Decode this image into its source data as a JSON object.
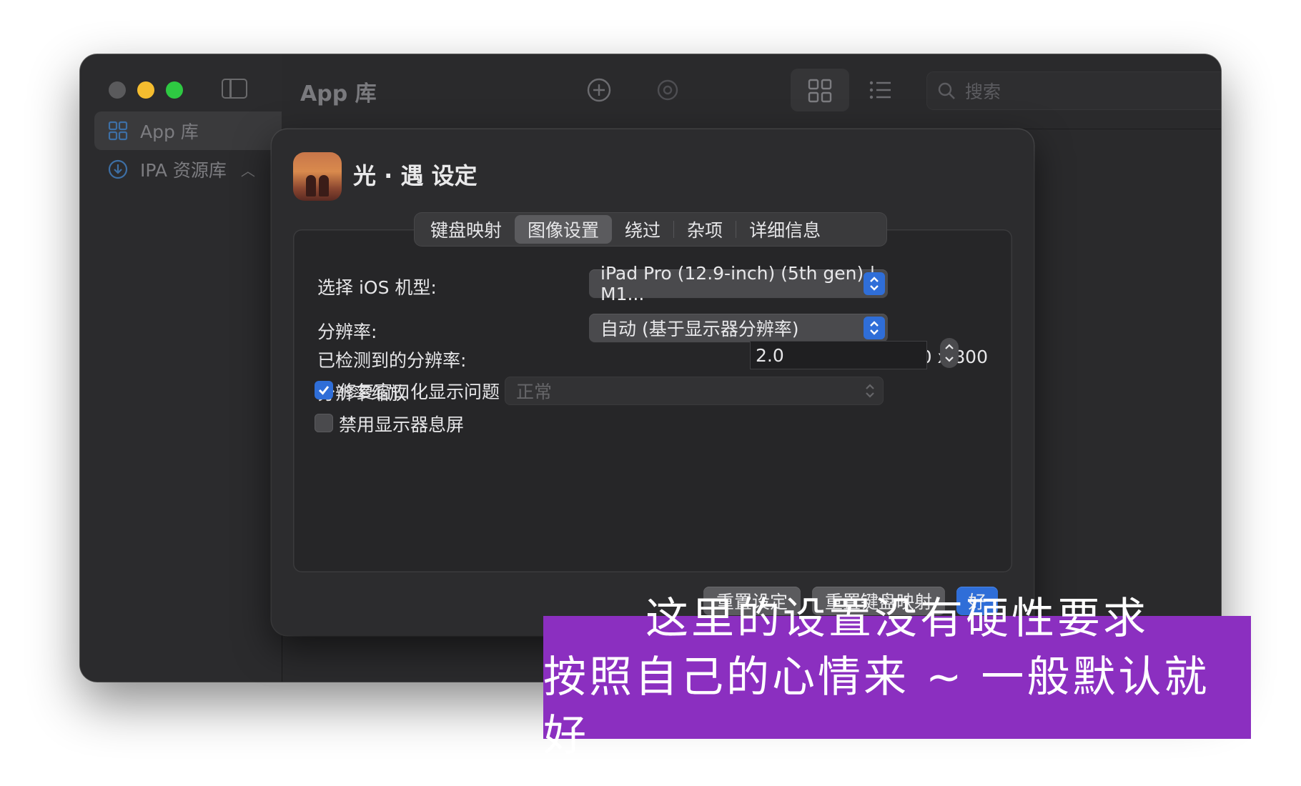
{
  "sidebar": {
    "items": [
      {
        "label": "App 库",
        "icon": "grid-icon"
      },
      {
        "label": "IPA 资源库",
        "icon": "download-circle-icon"
      }
    ]
  },
  "toolbar": {
    "title": "App 库",
    "search_placeholder": "搜索"
  },
  "sheet": {
    "title": "光 · 遇 设定",
    "tabs": [
      {
        "label": "键盘映射"
      },
      {
        "label": "图像设置",
        "selected": true
      },
      {
        "label": "绕过"
      },
      {
        "label": "杂项"
      },
      {
        "label": "详细信息"
      }
    ],
    "fields": {
      "device_label": "选择 iOS 机型:",
      "device_value": "iPad Pro (12.9-inch) (5th gen) | M1...",
      "resolution_label": "分辨率:",
      "resolution_value": "自动 (基于显示器分辨率)",
      "detected_label": "已检测到的分辨率:",
      "detected_value": "1,280 x 800",
      "scale_label": "分辨率缩放",
      "scale_value": "2.0",
      "fix_window_label": "修复窗口化显示问题",
      "fix_window_checked": true,
      "fix_window_mode": "正常",
      "disable_sleep_label": "禁用显示器息屏",
      "disable_sleep_checked": false
    },
    "buttons": {
      "reset_settings": "重置设定",
      "reset_keymap": "重置键盘映射",
      "ok": "好"
    }
  },
  "caption": {
    "line1": "这里的设置没有硬性要求",
    "line2": "按照自己的心情来 ~ 一般默认就好"
  },
  "colors": {
    "accent": "#2f6ed8",
    "caption_bg": "#8b2fc0"
  }
}
